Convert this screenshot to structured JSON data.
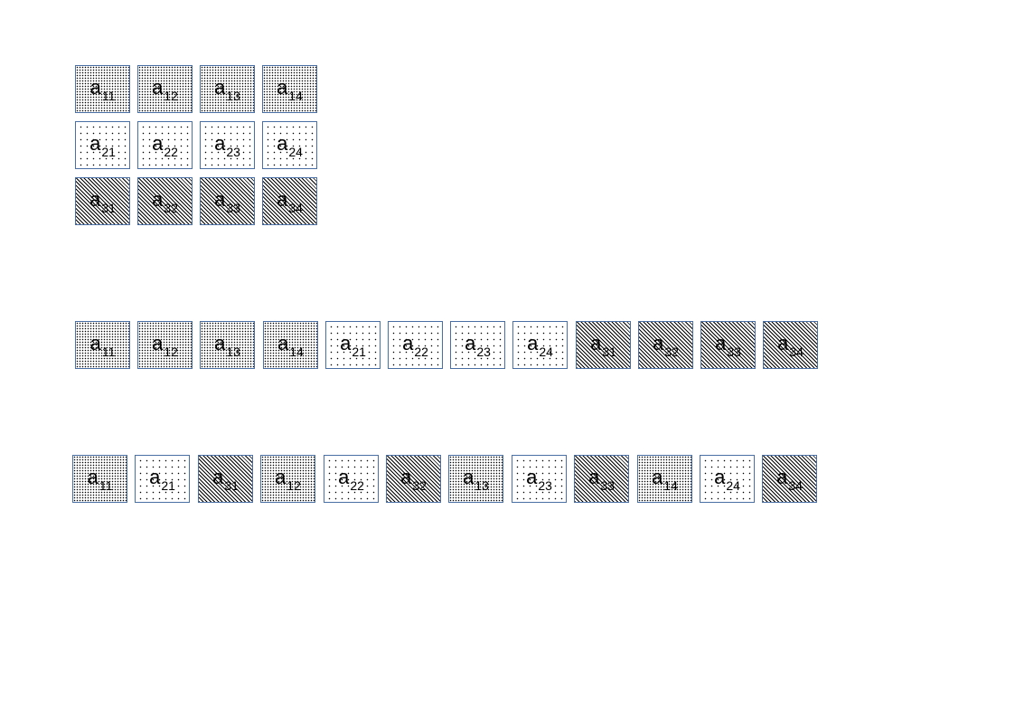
{
  "diagram": {
    "matrix": {
      "rows": [
        [
          {
            "base": "a",
            "sub": "11",
            "pattern": "dense"
          },
          {
            "base": "a",
            "sub": "12",
            "pattern": "dense"
          },
          {
            "base": "a",
            "sub": "13",
            "pattern": "dense"
          },
          {
            "base": "a",
            "sub": "14",
            "pattern": "dense"
          }
        ],
        [
          {
            "base": "a",
            "sub": "21",
            "pattern": "sparse"
          },
          {
            "base": "a",
            "sub": "22",
            "pattern": "sparse"
          },
          {
            "base": "a",
            "sub": "23",
            "pattern": "sparse"
          },
          {
            "base": "a",
            "sub": "24",
            "pattern": "sparse"
          }
        ],
        [
          {
            "base": "a",
            "sub": "31",
            "pattern": "hatch"
          },
          {
            "base": "a",
            "sub": "32",
            "pattern": "hatch"
          },
          {
            "base": "a",
            "sub": "33",
            "pattern": "hatch"
          },
          {
            "base": "a",
            "sub": "34",
            "pattern": "hatch"
          }
        ]
      ]
    },
    "row_major": [
      {
        "base": "a",
        "sub": "11",
        "pattern": "dense"
      },
      {
        "base": "a",
        "sub": "12",
        "pattern": "dense"
      },
      {
        "base": "a",
        "sub": "13",
        "pattern": "dense"
      },
      {
        "base": "a",
        "sub": "14",
        "pattern": "dense"
      },
      {
        "base": "a",
        "sub": "21",
        "pattern": "sparse"
      },
      {
        "base": "a",
        "sub": "22",
        "pattern": "sparse"
      },
      {
        "base": "a",
        "sub": "23",
        "pattern": "sparse"
      },
      {
        "base": "a",
        "sub": "24",
        "pattern": "sparse"
      },
      {
        "base": "a",
        "sub": "31",
        "pattern": "hatch"
      },
      {
        "base": "a",
        "sub": "32",
        "pattern": "hatch"
      },
      {
        "base": "a",
        "sub": "33",
        "pattern": "hatch"
      },
      {
        "base": "a",
        "sub": "34",
        "pattern": "hatch"
      }
    ],
    "column_major": [
      {
        "base": "a",
        "sub": "11",
        "pattern": "dense"
      },
      {
        "base": "a",
        "sub": "21",
        "pattern": "sparse"
      },
      {
        "base": "a",
        "sub": "31",
        "pattern": "hatch"
      },
      {
        "base": "a",
        "sub": "12",
        "pattern": "dense"
      },
      {
        "base": "a",
        "sub": "22",
        "pattern": "sparse"
      },
      {
        "base": "a",
        "sub": "32",
        "pattern": "hatch"
      },
      {
        "base": "a",
        "sub": "13",
        "pattern": "dense"
      },
      {
        "base": "a",
        "sub": "23",
        "pattern": "sparse"
      },
      {
        "base": "a",
        "sub": "33",
        "pattern": "hatch"
      },
      {
        "base": "a",
        "sub": "14",
        "pattern": "dense"
      },
      {
        "base": "a",
        "sub": "24",
        "pattern": "sparse"
      },
      {
        "base": "a",
        "sub": "34",
        "pattern": "hatch"
      }
    ],
    "colors": {
      "cell_border": "#4a6fa5",
      "text": "#000000",
      "background": "#ffffff"
    }
  }
}
